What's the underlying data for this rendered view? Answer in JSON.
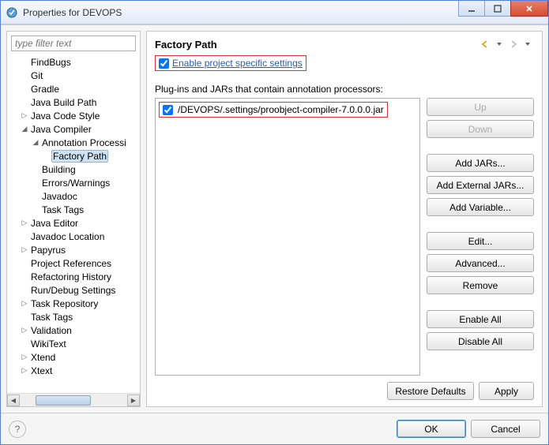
{
  "window": {
    "title": "Properties for DEVOPS"
  },
  "filter": {
    "placeholder": "type filter text"
  },
  "tree": [
    {
      "label": "FindBugs",
      "indent": 1,
      "arrow": ""
    },
    {
      "label": "Git",
      "indent": 1,
      "arrow": ""
    },
    {
      "label": "Gradle",
      "indent": 1,
      "arrow": ""
    },
    {
      "label": "Java Build Path",
      "indent": 1,
      "arrow": ""
    },
    {
      "label": "Java Code Style",
      "indent": 1,
      "arrow": "▷"
    },
    {
      "label": "Java Compiler",
      "indent": 1,
      "arrow": "◢"
    },
    {
      "label": "Annotation Processi",
      "indent": 2,
      "arrow": "◢"
    },
    {
      "label": "Factory Path",
      "indent": 3,
      "arrow": "",
      "selected": true
    },
    {
      "label": "Building",
      "indent": 2,
      "arrow": ""
    },
    {
      "label": "Errors/Warnings",
      "indent": 2,
      "arrow": ""
    },
    {
      "label": "Javadoc",
      "indent": 2,
      "arrow": ""
    },
    {
      "label": "Task Tags",
      "indent": 2,
      "arrow": ""
    },
    {
      "label": "Java Editor",
      "indent": 1,
      "arrow": "▷"
    },
    {
      "label": "Javadoc Location",
      "indent": 1,
      "arrow": ""
    },
    {
      "label": "Papyrus",
      "indent": 1,
      "arrow": "▷"
    },
    {
      "label": "Project References",
      "indent": 1,
      "arrow": ""
    },
    {
      "label": "Refactoring History",
      "indent": 1,
      "arrow": ""
    },
    {
      "label": "Run/Debug Settings",
      "indent": 1,
      "arrow": ""
    },
    {
      "label": "Task Repository",
      "indent": 1,
      "arrow": "▷"
    },
    {
      "label": "Task Tags",
      "indent": 1,
      "arrow": ""
    },
    {
      "label": "Validation",
      "indent": 1,
      "arrow": "▷"
    },
    {
      "label": "WikiText",
      "indent": 1,
      "arrow": ""
    },
    {
      "label": "Xtend",
      "indent": 1,
      "arrow": "▷"
    },
    {
      "label": "Xtext",
      "indent": 1,
      "arrow": "▷"
    }
  ],
  "page": {
    "title": "Factory Path",
    "enable_label": "Enable project specific settings",
    "subheader": "Plug-ins and JARs that contain annotation processors:",
    "entry": "/DEVOPS/.settings/proobject-compiler-7.0.0.0.jar"
  },
  "buttons": {
    "up": "Up",
    "down": "Down",
    "add_jars": "Add JARs...",
    "add_ext": "Add External JARs...",
    "add_var": "Add Variable...",
    "edit": "Edit...",
    "advanced": "Advanced...",
    "remove": "Remove",
    "enable_all": "Enable All",
    "disable_all": "Disable All",
    "restore": "Restore Defaults",
    "apply": "Apply",
    "ok": "OK",
    "cancel": "Cancel"
  }
}
